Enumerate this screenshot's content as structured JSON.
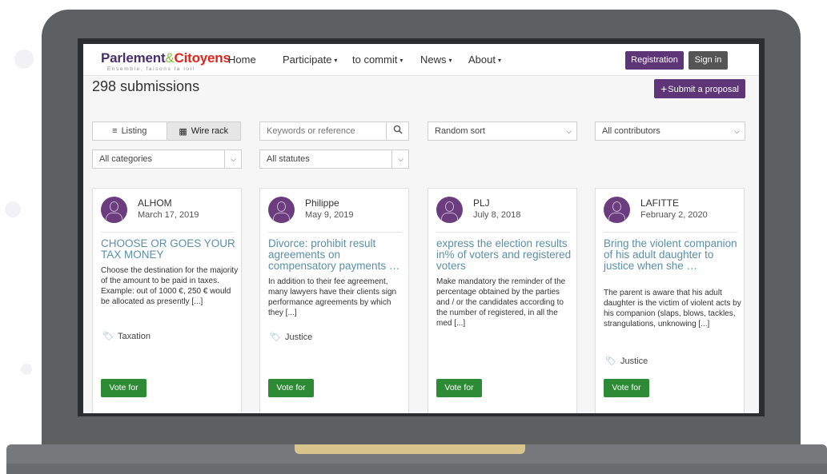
{
  "logo": {
    "main_part1": "Parlement",
    "amp": "&",
    "main_part2": "Citoyens",
    "tagline": "Ensemble, faisons la loi!"
  },
  "nav": {
    "home": "Home",
    "participate": "Participate",
    "commit": "to commit",
    "news": "News",
    "about": "About",
    "caret": "▾"
  },
  "auth": {
    "registration": "Registration",
    "sign_in": "Sign in"
  },
  "page": {
    "count": "298 submissions",
    "submit_label": "Submit a proposal",
    "submit_plus": "+"
  },
  "filters": {
    "listing": "Listing",
    "wire_rack": "Wire rack",
    "search_placeholder": "Keywords or reference",
    "sort": "Random sort",
    "contributors": "All contributors",
    "categories": "All categories",
    "statutes": "All statutes"
  },
  "cards": [
    {
      "author": "ALHOM",
      "date": "March 17, 2019",
      "title": "CHOOSE OR GOES YOUR TAX MONEY",
      "description": "Choose the destination for the majority of the amount to be paid in taxes. Example: out of 1000 €, 250 € would be allocated as presently [...]",
      "tag": "Taxation",
      "vote": "Vote for"
    },
    {
      "author": "Philippe",
      "date": "May 9, 2019",
      "title": "Divorce: prohibit result agreements on compensatory payments …",
      "description": "In addition to their fee agreement, many lawyers have their clients sign performance agreements by which they [...]",
      "tag": "Justice",
      "vote": "Vote for"
    },
    {
      "author": "PLJ",
      "date": "July 8, 2018",
      "title": "express the election results in% of voters and registered voters",
      "description": "Make mandatory the reminder of the percentage obtained by the parties and / or the candidates according to the number of registered, in all the med [...]",
      "tag": "",
      "vote": "Vote for"
    },
    {
      "author": "LAFITTE",
      "date": "February 2, 2020",
      "title": "Bring the violent companion of his adult daughter to justice when she …",
      "description": "The parent is aware that his adult daughter is the victim of violent acts by his companion (slaps, blows, tackles, strangulations, unknowing [...]",
      "tag": "Justice",
      "vote": "Vote for"
    }
  ],
  "colors": {
    "brand_purple": "#5e3576",
    "vote_green": "#2e8b35",
    "title_blue": "#5a8fa8",
    "laptop_gray": "#5e5f61"
  }
}
